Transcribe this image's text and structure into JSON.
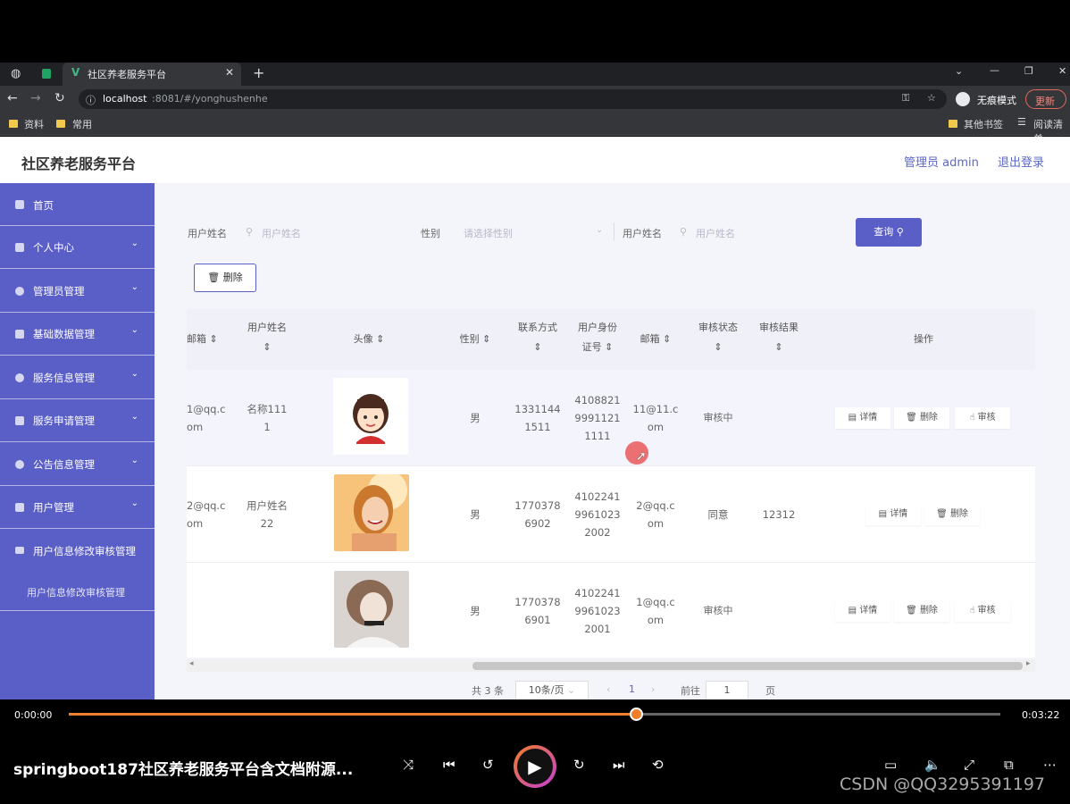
{
  "browser": {
    "tab_title": "社区养老服务平台",
    "url_host": "localhost",
    "url_rest": ":8081/#/yonghushenhe",
    "incognito_label": "无痕模式",
    "update_label": "更新",
    "bookmarks": [
      "资料",
      "常用"
    ],
    "bookmarks_right": [
      "其他书签",
      "阅读清单"
    ]
  },
  "header": {
    "brand": "社区养老服务平台",
    "admin_label": "管理员 admin",
    "logout_label": "退出登录"
  },
  "sidebar": {
    "items": [
      {
        "label": "首页"
      },
      {
        "label": "个人中心"
      },
      {
        "label": "管理员管理"
      },
      {
        "label": "基础数据管理"
      },
      {
        "label": "服务信息管理"
      },
      {
        "label": "服务申请管理"
      },
      {
        "label": "公告信息管理"
      },
      {
        "label": "用户管理"
      },
      {
        "label": "用户信息修改审核管理"
      }
    ],
    "submenu_label": "用户信息修改审核管理"
  },
  "search": {
    "label1": "用户姓名",
    "placeholder1": "用户姓名",
    "label2": "性别",
    "placeholder2": "请选择性别",
    "label3": "用户姓名",
    "placeholder3": "用户姓名",
    "query_button": "查询",
    "delete_button": "删除"
  },
  "table": {
    "columns": [
      "邮箱",
      "用户姓名",
      "头像",
      "性别",
      "联系方式",
      "用户身份证号",
      "邮箱",
      "审核状态",
      "审核结果",
      "操作"
    ],
    "rows": [
      {
        "email1": [
          "1@qq.c",
          "om"
        ],
        "name": [
          "名称111",
          "1"
        ],
        "gender": "男",
        "phone": [
          "1331144",
          "1511"
        ],
        "idcard": [
          "4108821",
          "9991121",
          "1111"
        ],
        "email2": [
          "11@11.c",
          "om"
        ],
        "status": "审核中",
        "result": "",
        "ops": [
          "详情",
          "删除",
          "审核"
        ]
      },
      {
        "email1": [
          "2@qq.c",
          "om"
        ],
        "name": [
          "用户姓名",
          "22"
        ],
        "gender": "男",
        "phone": [
          "1770378",
          "6902"
        ],
        "idcard": [
          "4102241",
          "9961023",
          "2002"
        ],
        "email2": [
          "2@qq.c",
          "om"
        ],
        "status": "同意",
        "result": "12312",
        "ops": [
          "详情",
          "删除"
        ]
      },
      {
        "email1": [
          "",
          ""
        ],
        "name": [
          "",
          ""
        ],
        "gender": "男",
        "phone": [
          "1770378",
          "6901"
        ],
        "idcard": [
          "4102241",
          "9961023",
          "2001"
        ],
        "email2": [
          "1@qq.c",
          "om"
        ],
        "status": "审核中",
        "result": "",
        "ops": [
          "详情",
          "删除",
          "审核"
        ]
      }
    ]
  },
  "pager": {
    "total": "共 3 条",
    "page_size": "10条/页",
    "current": "1",
    "goto_label": "前往",
    "goto_value": "1",
    "page_suffix": "页"
  },
  "player": {
    "time_current": "0:00:00",
    "time_total": "0:03:22",
    "progress": 0.61,
    "title": "springboot187社区养老服务平台含文档附源...",
    "watermark": "CSDN @QQ3295391197"
  },
  "colors": {
    "accent": "#5a5ec7",
    "progress": "#f07e2a"
  }
}
